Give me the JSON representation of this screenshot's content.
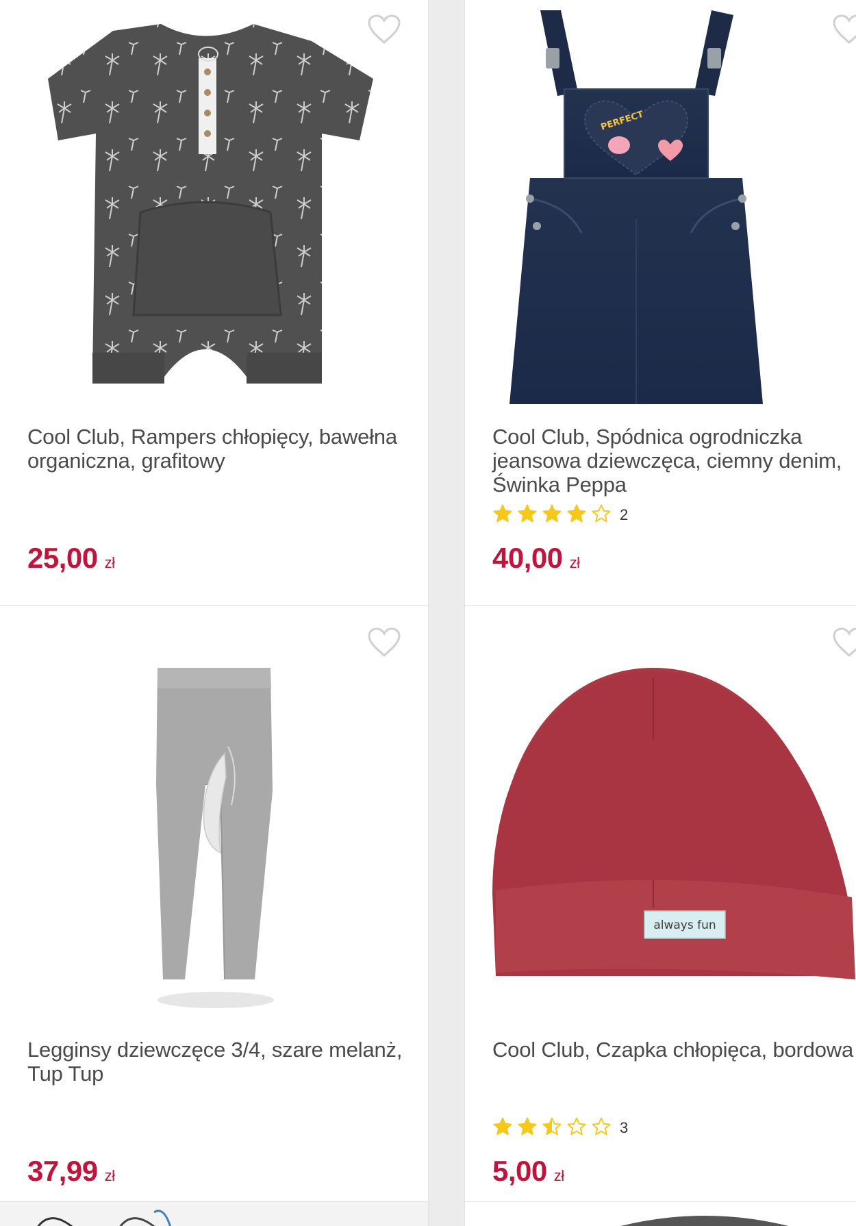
{
  "products": [
    {
      "title": "Cool Club, Rampers chłopięcy, bawełna organiczna, grafitowy",
      "price": "25,00",
      "currency": "zł",
      "image": "graphite-palm-romper"
    },
    {
      "title": "Cool Club, Spódnica ogrodniczka jeansowa dziewczęca, ciemny denim, Świnka Peppa",
      "price": "40,00",
      "currency": "zł",
      "rating_value": 4,
      "rating_count": "2",
      "image": "denim-overall-dress"
    },
    {
      "title": "Legginsy dziewczęce 3/4, szare melanż, Tup Tup",
      "price": "37,99",
      "currency": "zł",
      "image": "grey-leggings"
    },
    {
      "title": "Cool Club, Czapka chłopięca, bordowa",
      "price": "5,00",
      "currency": "zł",
      "rating_value": 2.5,
      "rating_count": "3",
      "image": "burgundy-beanie",
      "label_text": "always fun"
    }
  ],
  "colors": {
    "price": "#c0143c",
    "star": "#f6c81b",
    "heart_outline": "#d0d0d0"
  },
  "icons": {
    "favorite": "heart-outline-icon",
    "rating": "star-icon"
  }
}
